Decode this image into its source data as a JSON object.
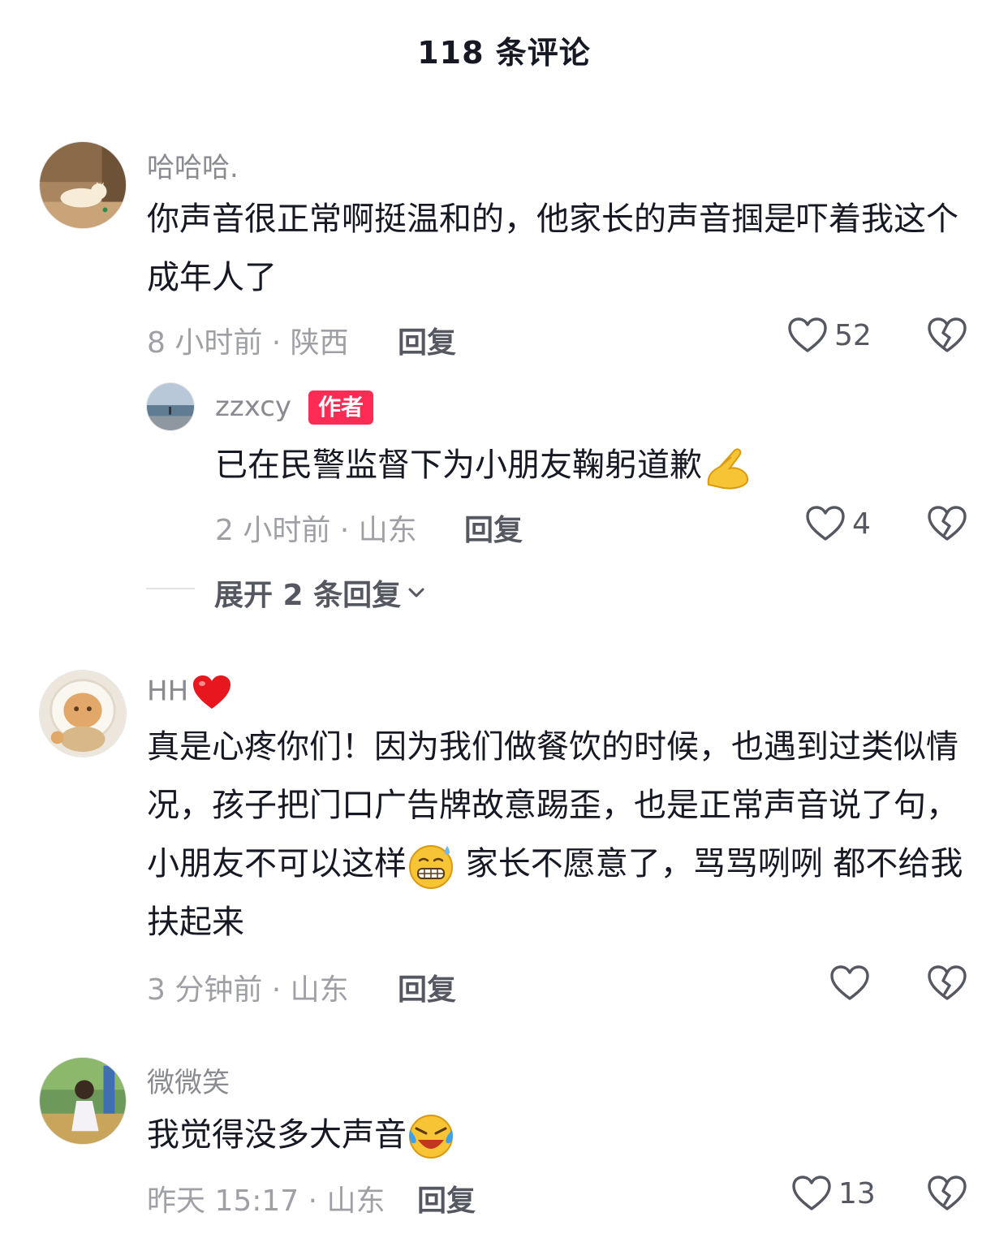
{
  "header": {
    "title": "118 条评论"
  },
  "comments": [
    {
      "username": "哈哈哈.",
      "text": "你声音很正常啊挺温和的，他家长的声音掴是吓着我这个成年人了",
      "meta": "8 小时前 · 陕西",
      "reply_label": "回复",
      "likes": "52",
      "replies": [
        {
          "username": "zzxcy",
          "badge": "作者",
          "text": "已在民警监督下为小朋友鞠躬道歉",
          "emoji": "folded-hands-emoji",
          "meta": "2 小时前 · 山东",
          "reply_label": "回复",
          "likes": "4"
        }
      ],
      "expand_label": "展开 2 条回复"
    },
    {
      "username": "HH",
      "username_emoji": "red-heart-emoji",
      "text_part1": "真是心疼你们！因为我们做餐饮的时候，也遇到过类似情况，孩子把门口广告牌故意踢歪，也是正常声音说了句，小朋友不可以这样",
      "text_emoji": "grimacing-sweat-emoji",
      "text_part2": " 家长不愿意了，骂骂咧咧  都不给我扶起来",
      "meta": "3 分钟前 · 山东",
      "reply_label": "回复",
      "likes": ""
    },
    {
      "username": "微微笑",
      "text": "我觉得没多大声音",
      "text_emoji": "crying-laughing-emoji",
      "meta": "昨天 15:17 · 山东",
      "reply_label": "回复",
      "likes": "13"
    }
  ],
  "colors": {
    "accent": "#fe2c55",
    "text": "#161823",
    "muted": "#9fa0a5",
    "action": "#555761"
  }
}
